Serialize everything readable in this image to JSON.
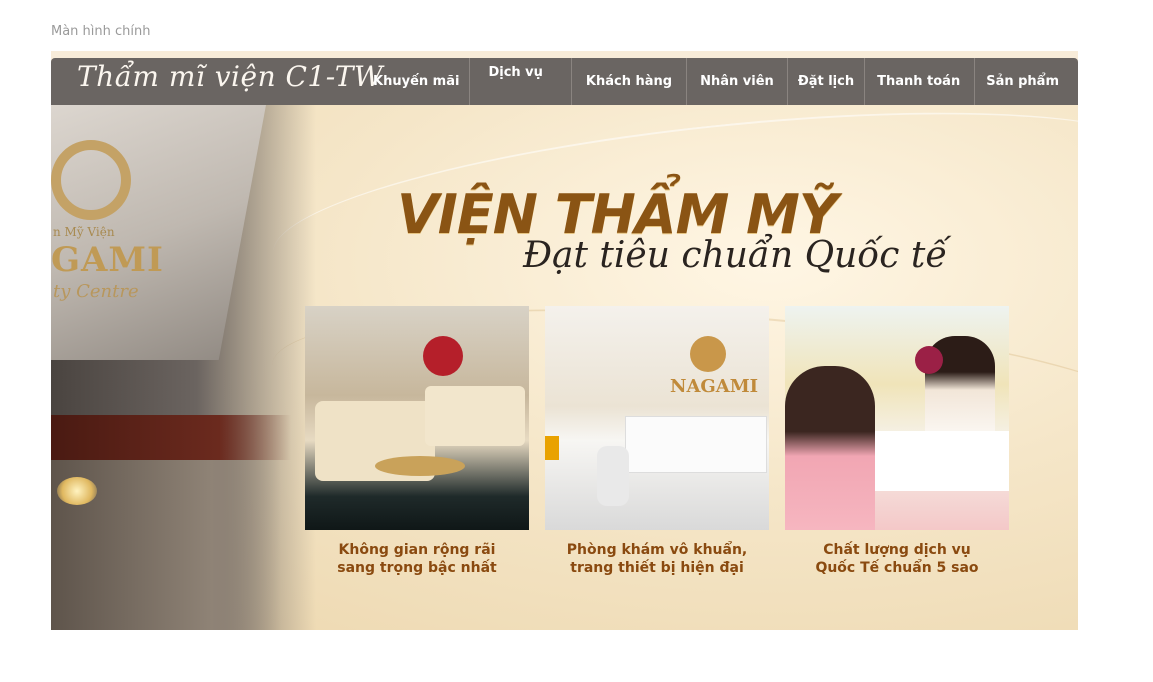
{
  "page": {
    "label": "Màn hình chính"
  },
  "nav": {
    "brand": "Thẩm mĩ viện C1-TW",
    "items": [
      "Khuyến mãi",
      "Dịch vụ",
      "Khách hàng",
      "Nhân viên",
      "Đặt lịch",
      "Thanh toán",
      "Sản phẩm"
    ]
  },
  "banner": {
    "headline": "VIỆN THẨM MỸ",
    "subheadline": "Đạt tiêu chuẩn Quốc tế",
    "storefront_sign": [
      "n Mỹ Viện",
      "GAMI",
      "ty Centre"
    ],
    "clinic_sign": "NAGAMI",
    "cards": [
      {
        "caption_line1": "Không gian rộng rãi",
        "caption_line2": "sang trọng bậc nhất"
      },
      {
        "caption_line1": "Phòng khám vô khuẩn,",
        "caption_line2": "trang thiết bị hiện đại"
      },
      {
        "caption_line1": "Chất lượng dịch vụ",
        "caption_line2": "Quốc Tế chuẩn 5 sao"
      }
    ]
  },
  "colors": {
    "nav_bg": "#6a6562",
    "accent_gold": "#8a5414",
    "caption": "#8a4a10",
    "hero_bg": "#f5e6c8"
  }
}
